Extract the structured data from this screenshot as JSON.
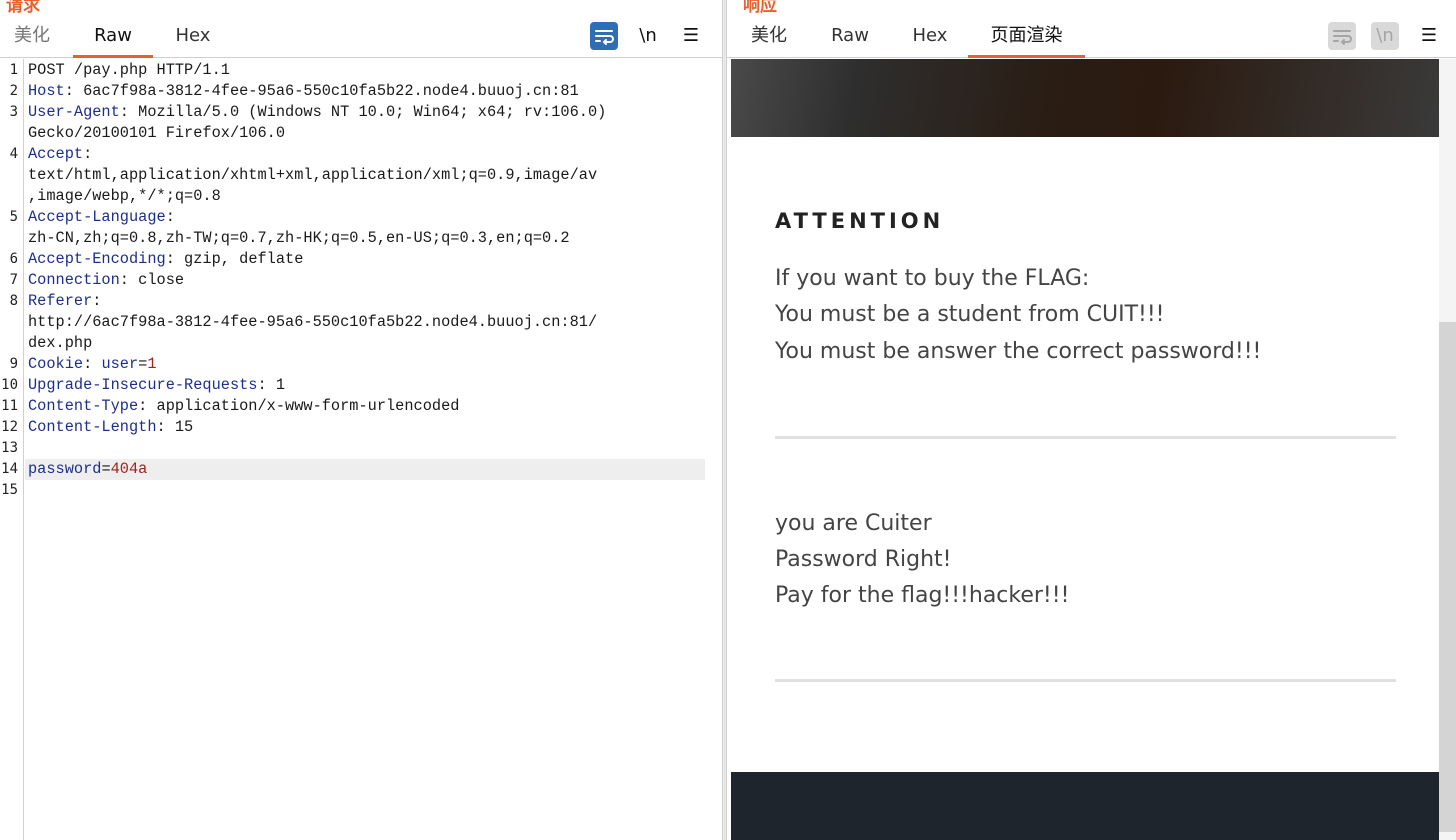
{
  "request": {
    "title": "请求",
    "tabs": [
      "美化",
      "Raw",
      "Hex"
    ],
    "tools": {
      "wrap": "⇌",
      "newline": "\\n",
      "menu": "☰"
    },
    "lines": [
      {
        "n": "1",
        "parts": [
          [
            "t",
            "POST /pay.php HTTP/1.1"
          ]
        ]
      },
      {
        "n": "2",
        "parts": [
          [
            "k",
            "Host"
          ],
          [
            "t",
            ": 6ac7f98a-3812-4fee-95a6-550c10fa5b22.node4.buuoj.cn:81"
          ]
        ]
      },
      {
        "n": "3",
        "parts": [
          [
            "k",
            "User-Agent"
          ],
          [
            "t",
            ": Mozilla/5.0 (Windows NT 10.0; Win64; x64; rv:106.0)"
          ]
        ]
      },
      {
        "n": "",
        "parts": [
          [
            "t",
            "Gecko/20100101 Firefox/106.0"
          ]
        ]
      },
      {
        "n": "4",
        "parts": [
          [
            "k",
            "Accept"
          ],
          [
            "t",
            ":"
          ]
        ]
      },
      {
        "n": "",
        "parts": [
          [
            "t",
            "text/html,application/xhtml+xml,application/xml;q=0.9,image/av"
          ]
        ]
      },
      {
        "n": "",
        "parts": [
          [
            "t",
            ",image/webp,*/*;q=0.8"
          ]
        ]
      },
      {
        "n": "5",
        "parts": [
          [
            "k",
            "Accept-Language"
          ],
          [
            "t",
            ":"
          ]
        ]
      },
      {
        "n": "",
        "parts": [
          [
            "t",
            "zh-CN,zh;q=0.8,zh-TW;q=0.7,zh-HK;q=0.5,en-US;q=0.3,en;q=0.2"
          ]
        ]
      },
      {
        "n": "6",
        "parts": [
          [
            "k",
            "Accept-Encoding"
          ],
          [
            "t",
            ": gzip, deflate"
          ]
        ]
      },
      {
        "n": "7",
        "parts": [
          [
            "k",
            "Connection"
          ],
          [
            "t",
            ": close"
          ]
        ]
      },
      {
        "n": "8",
        "parts": [
          [
            "k",
            "Referer"
          ],
          [
            "t",
            ":"
          ]
        ]
      },
      {
        "n": "",
        "parts": [
          [
            "t",
            "http://6ac7f98a-3812-4fee-95a6-550c10fa5b22.node4.buuoj.cn:81/"
          ]
        ]
      },
      {
        "n": "",
        "parts": [
          [
            "t",
            "dex.php"
          ]
        ]
      },
      {
        "n": "9",
        "parts": [
          [
            "k",
            "Cookie"
          ],
          [
            "t",
            ": "
          ],
          [
            "k",
            "user"
          ],
          [
            "t",
            "="
          ],
          [
            "v",
            "1"
          ]
        ]
      },
      {
        "n": "10",
        "parts": [
          [
            "k",
            "Upgrade-Insecure-Requests"
          ],
          [
            "t",
            ": 1"
          ]
        ]
      },
      {
        "n": "11",
        "parts": [
          [
            "k",
            "Content-Type"
          ],
          [
            "t",
            ": application/x-www-form-urlencoded"
          ]
        ]
      },
      {
        "n": "12",
        "parts": [
          [
            "k",
            "Content-Length"
          ],
          [
            "t",
            ": 15"
          ]
        ]
      },
      {
        "n": "13",
        "parts": []
      },
      {
        "n": "14",
        "parts": [
          [
            "k",
            "password"
          ],
          [
            "t",
            "="
          ],
          [
            "v",
            "404a"
          ]
        ]
      },
      {
        "n": "15",
        "parts": []
      }
    ]
  },
  "response": {
    "title": "响应",
    "tabs": [
      "美化",
      "Raw",
      "Hex",
      "页面渲染"
    ],
    "tools": {
      "wrap": "⇌",
      "newline": "\\n",
      "menu": "☰"
    },
    "page": {
      "attention_title": "ATTENTION",
      "attention_lines": [
        "If you want to buy the FLAG:",
        "You must be a student from CUIT!!!",
        "You must be answer the correct password!!!"
      ],
      "result_lines": [
        "you are Cuiter",
        "Password Right!",
        "Pay for the flag!!!hacker!!!"
      ]
    }
  }
}
